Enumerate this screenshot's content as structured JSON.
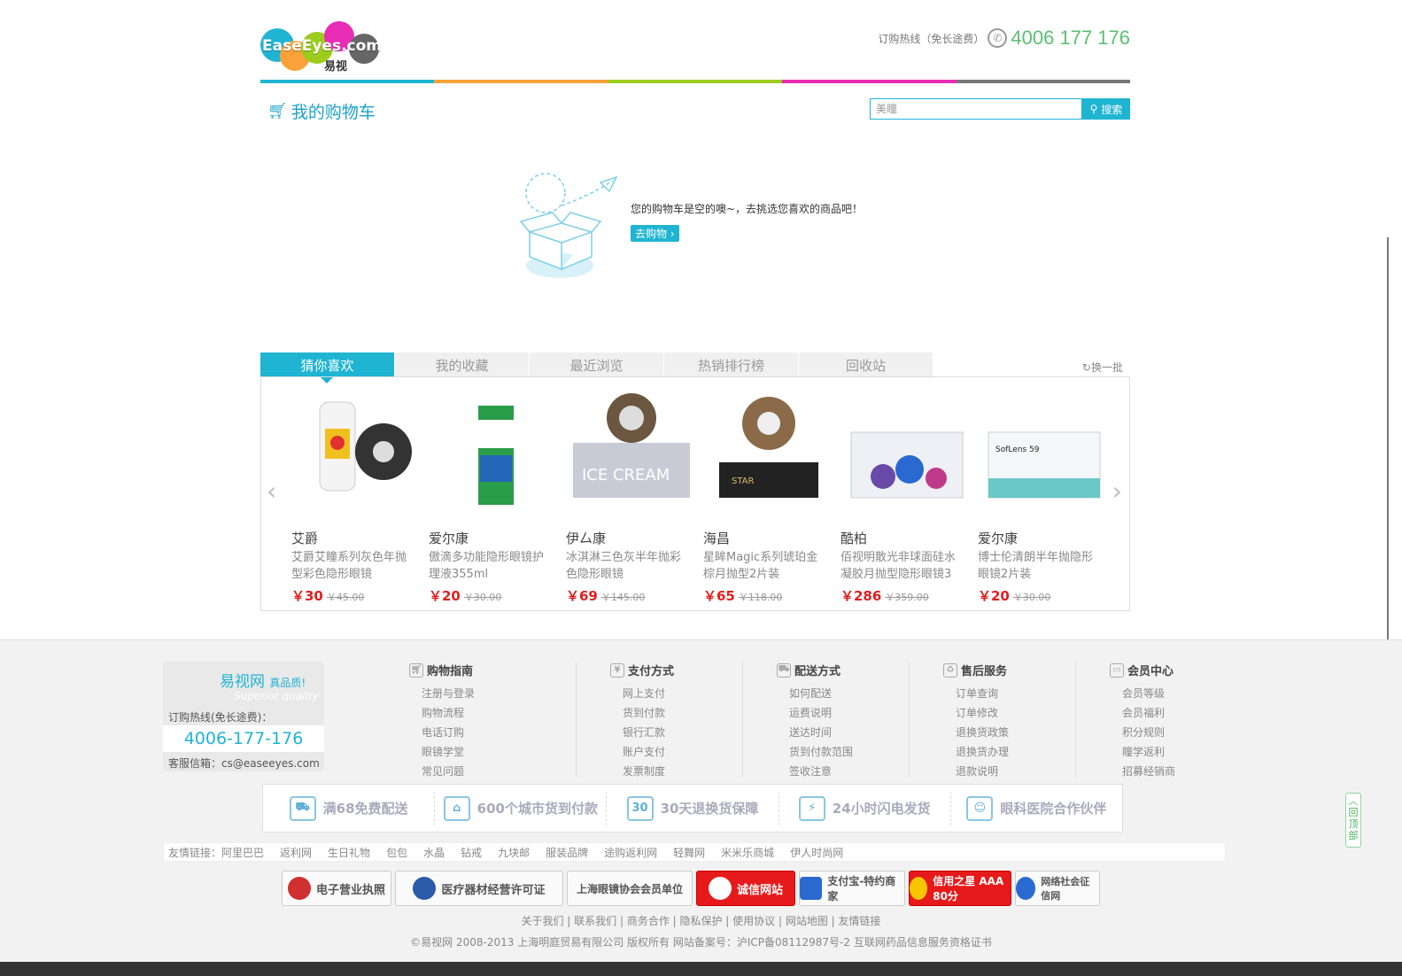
{
  "header": {
    "logo_text": "EaseEyes.com",
    "logo_cn": "易视",
    "hotline_label": "订购热线（免长途费）",
    "hotline_number": "4006 177 176",
    "colors": [
      "#1fb4d2",
      "#f9a23a",
      "#9ccc1e",
      "#e82cb4",
      "#777777"
    ]
  },
  "cart": {
    "title": "我的购物车",
    "search_placeholder": "美瞳",
    "search_button": "搜索"
  },
  "empty": {
    "message": "您的购物车是空的噢~，去挑选您喜欢的商品吧！",
    "go_button": "去购物"
  },
  "recommend": {
    "tabs": [
      "猜你喜欢",
      "我的收藏",
      "最近浏览",
      "热销排行榜",
      "回收站"
    ],
    "refresh": "换一批",
    "products": [
      {
        "brand": "艾爵",
        "name": "艾爵艾瞳系列灰色年抛型彩色隐形眼镜",
        "price": "￥30",
        "old": "￥45.00"
      },
      {
        "brand": "爱尔康",
        "name": "傲滴多功能隐形眼镜护理液355ml",
        "price": "￥20",
        "old": "￥30.00"
      },
      {
        "brand": "伊厶康",
        "name": "冰淇淋三色灰半年抛彩色隐形眼镜",
        "price": "￥69",
        "old": "￥145.00"
      },
      {
        "brand": "海昌",
        "name": "星眸Magic系列琥珀金棕月抛型2片装",
        "price": "￥65",
        "old": "￥118.00"
      },
      {
        "brand": "酷柏",
        "name": "佰视明散光非球面硅水凝胶月抛型隐形眼镜3",
        "price": "￥286",
        "old": "￥359.00"
      },
      {
        "brand": "爱尔康",
        "name": "博士伦清朗半年抛隐形眼镜2片装",
        "price": "￥20",
        "old": "￥30.00"
      }
    ]
  },
  "footer": {
    "contact": {
      "brand": "易视网",
      "slogan": "真品质!",
      "sub": "Superior quality",
      "hotline_label": "订购热线(免长途费)：",
      "hotline": "4006-177-176",
      "email": "客服信箱：cs@easeeyes.com"
    },
    "columns": [
      {
        "title": "购物指南",
        "icon": "cart-icon",
        "items": [
          "注册与登录",
          "购物流程",
          "电话订购",
          "眼镜学堂",
          "常见问题"
        ]
      },
      {
        "title": "支付方式",
        "icon": "yen-icon",
        "items": [
          "网上支付",
          "货到付款",
          "银行汇款",
          "账户支付",
          "发票制度"
        ]
      },
      {
        "title": "配送方式",
        "icon": "car-icon",
        "items": [
          "如何配送",
          "运费说明",
          "送达时间",
          "货到付款范围",
          "签收注意"
        ]
      },
      {
        "title": "售后服务",
        "icon": "recycle-icon",
        "items": [
          "订单查询",
          "订单修改",
          "退换货政策",
          "退换货办理",
          "退款说明"
        ]
      },
      {
        "title": "会员中心",
        "icon": "monitor-icon",
        "items": [
          "会员等级",
          "会员福利",
          "积分规则",
          "瞳学返利",
          "招募经销商"
        ]
      }
    ],
    "services": [
      "满68免费配送",
      "600个城市货到付款",
      "30天退换货保障",
      "24小时闪电发货",
      "眼科医院合作伙伴"
    ],
    "friends_label": "友情链接：",
    "friends": [
      "阿里巴巴",
      "返利网",
      "生日礼物",
      "包包",
      "水晶",
      "钻戒",
      "九块邮",
      "服装品牌",
      "途购返利网",
      "轻舞网",
      "米米乐商城",
      "伊人时尚网"
    ],
    "badges": [
      "电子营业执照",
      "医疗器材经营许可证",
      "上海眼镜协会会员单位",
      "诚信网站",
      "支付宝-特约商家",
      "信用之星 AAA 80分",
      "网络社会征信网"
    ],
    "links": "关于我们 | 联系我们 | 商务合作 | 隐私保护 | 使用协议 | 网站地图 | 友情链接",
    "copyright": "©易视网 2008-2013 上海明庭贸易有限公司 版权所有 网站备案号：沪ICP备08112987号-2 互联网药品信息服务资格证书"
  },
  "totop": "回顶部"
}
